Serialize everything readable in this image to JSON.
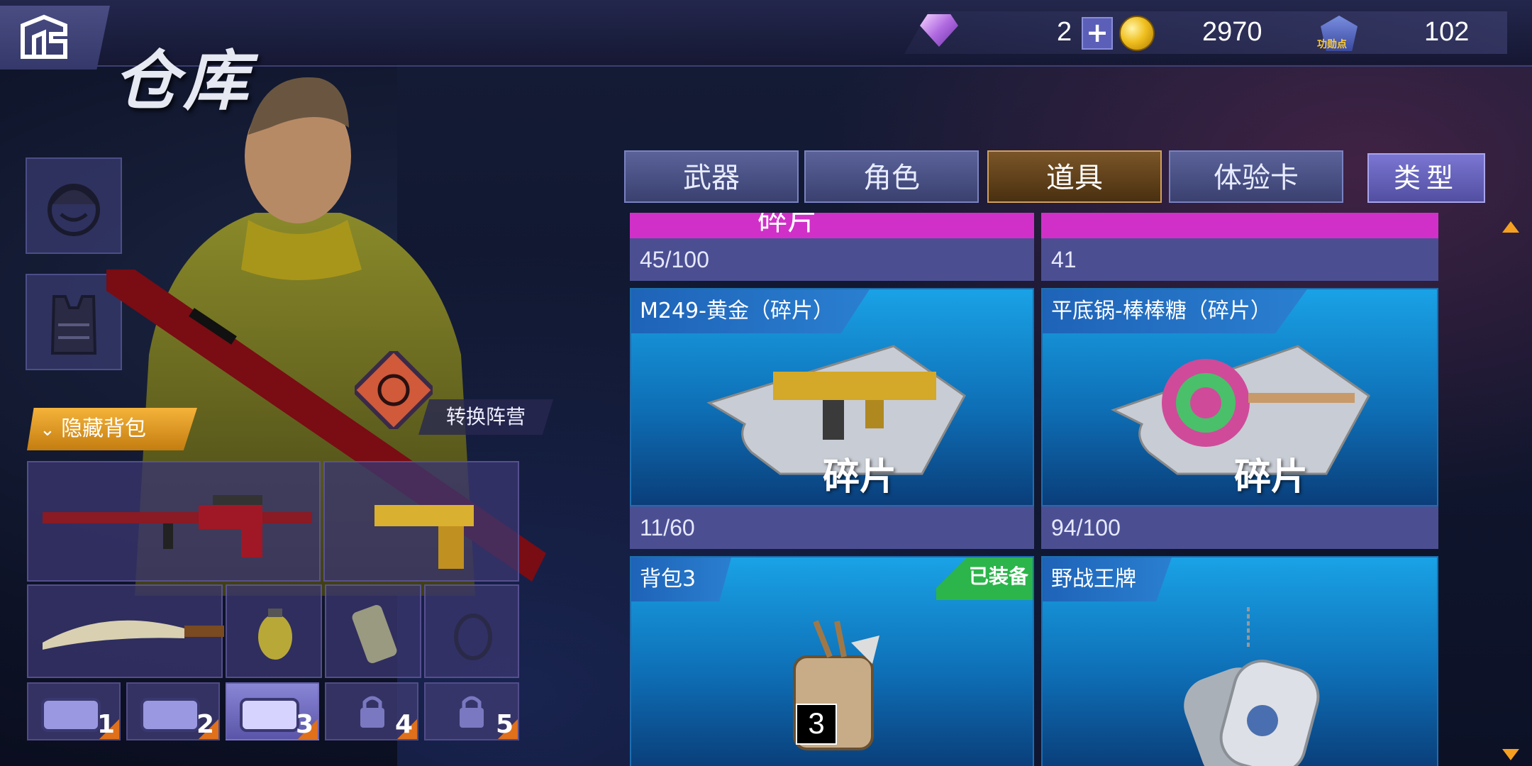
{
  "header": {
    "title": "仓库",
    "gems": "2",
    "plus": "+",
    "coins": "2970",
    "merit_points": "102",
    "merit_label": "功勋点"
  },
  "character": {
    "hide_bag_label": "隐藏背包",
    "switch_camp_label": "转换阵营"
  },
  "backpack": {
    "tabs": [
      "1",
      "2",
      "3",
      "4",
      "5"
    ],
    "active_tab": "3",
    "locked_tabs": [
      "4",
      "5"
    ]
  },
  "tabs": {
    "items": [
      "武器",
      "角色",
      "道具",
      "体验卡"
    ],
    "active": "道具",
    "type_button": "类型"
  },
  "items": {
    "top_partial_title": "碎片",
    "top_left_count": "45/100",
    "top_right_count": "41",
    "cards": [
      {
        "title": "M249-黄金（碎片）",
        "overlay": "碎片",
        "count": "11/60"
      },
      {
        "title": "平底锅-棒棒糖（碎片）",
        "overlay": "碎片",
        "count": "94/100"
      },
      {
        "title": "背包3",
        "badge": "已装备",
        "quantity": "3"
      },
      {
        "title": "野战王牌"
      }
    ]
  },
  "colors": {
    "active_tab": "#7a5528",
    "card_blue": "#1aa2e6",
    "count_bar": "#4b4f92",
    "equipped_badge": "#2cb54a",
    "hide_bag": "#f5b33a"
  }
}
